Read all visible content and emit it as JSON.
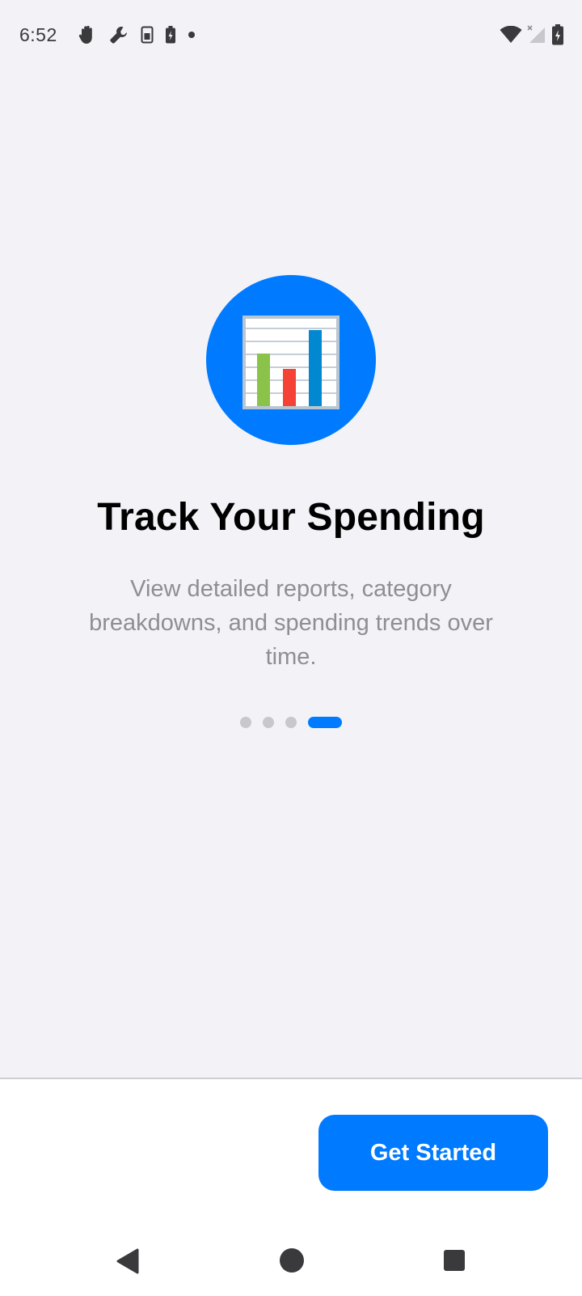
{
  "status_bar": {
    "time": "6:52",
    "left_icons": [
      "hand-icon",
      "wrench-icon",
      "sim-card-icon",
      "battery-saver-icon",
      "dot-icon"
    ],
    "right_icons": [
      "wifi-icon",
      "cellular-signal-icon",
      "battery-icon"
    ]
  },
  "onboarding": {
    "hero_icon": "bar-chart-icon",
    "title": "Track Your Spending",
    "subtitle": "View detailed reports, category breakdowns, and spending trends over time.",
    "page_count": 4,
    "current_page": 4
  },
  "footer": {
    "primary_button_label": "Get Started"
  },
  "nav_bar": {
    "buttons": [
      "back-icon",
      "home-icon",
      "recents-icon"
    ]
  },
  "colors": {
    "accent": "#007aff",
    "background": "#f2f2f7",
    "subtitle_text": "#8e8e93",
    "inactive_dot": "#c7c7cc"
  }
}
